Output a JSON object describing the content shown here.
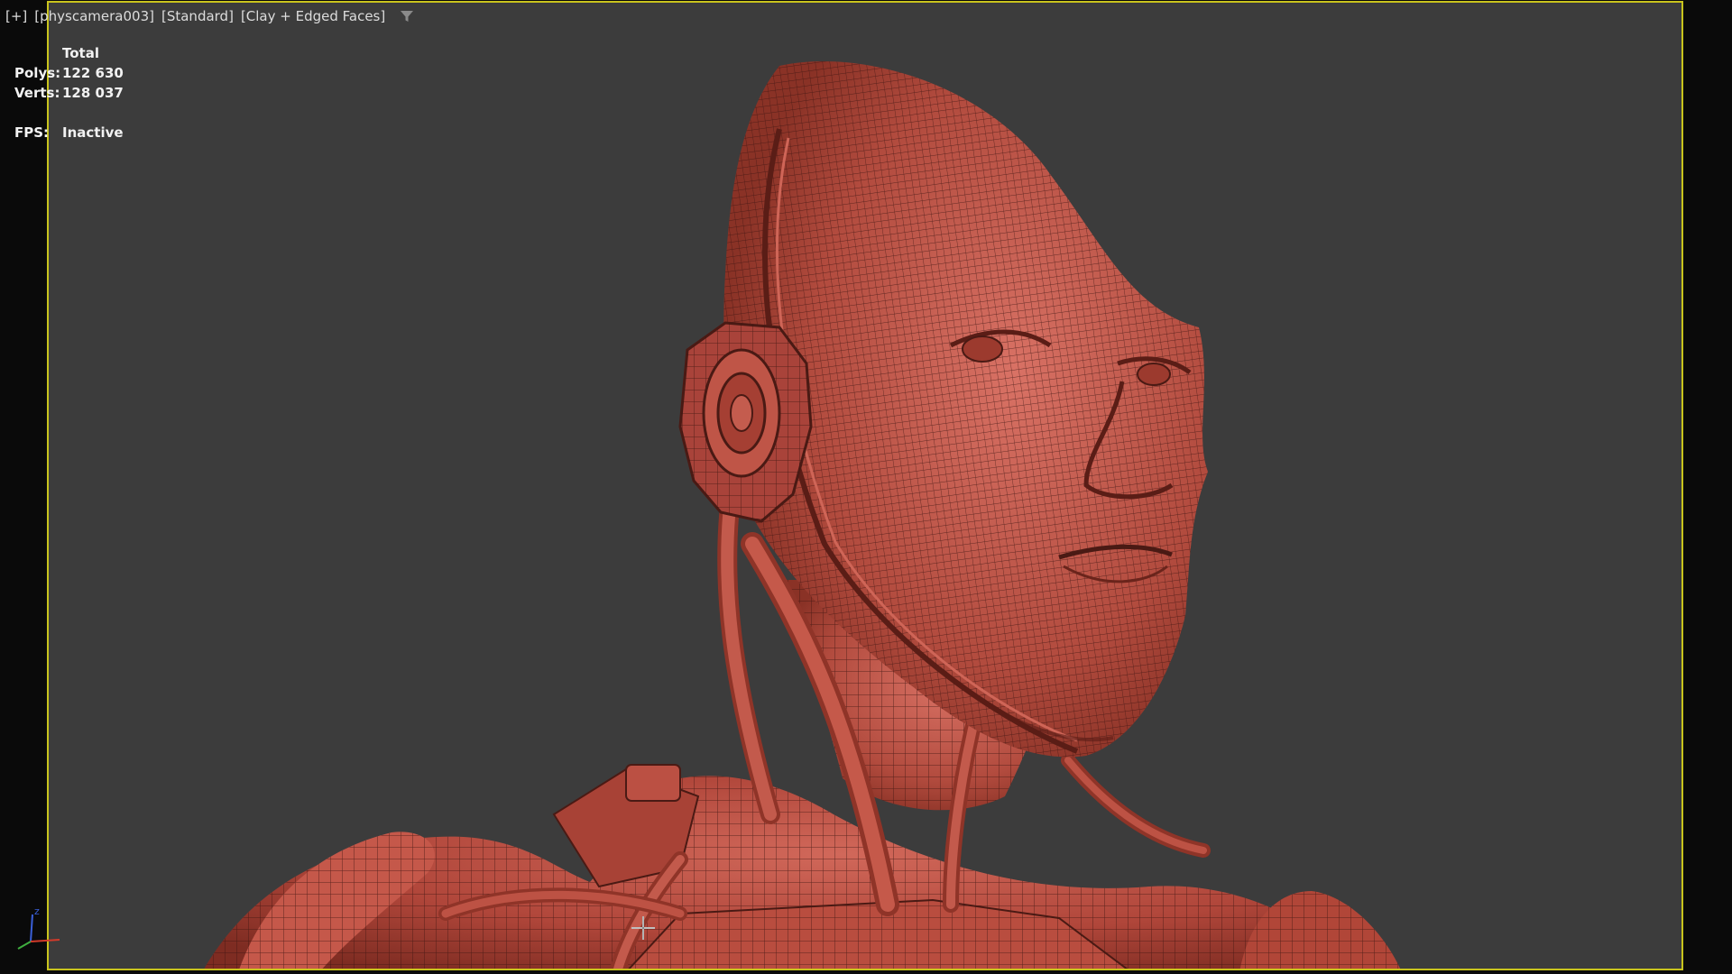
{
  "viewport": {
    "label_plus": "[+]",
    "label_camera": "[physcamera003]",
    "label_mode": "[Standard]",
    "label_shading": "[Clay + Edged Faces]",
    "filter_icon": "filter-icon"
  },
  "stats": {
    "header": "Total",
    "polys_label": "Polys:",
    "polys_value": "122 630",
    "verts_label": "Verts:",
    "verts_value": "128 037",
    "fps_label": "FPS:",
    "fps_value": "Inactive"
  },
  "gizmo": {
    "z_label": "z",
    "x_color": "#d23a2a",
    "y_color": "#3fae3f",
    "z_color": "#3a5fd8"
  },
  "colors": {
    "frame_border": "#c9c41d",
    "background": "#3c3c3c",
    "clay": "#b84a3c"
  }
}
